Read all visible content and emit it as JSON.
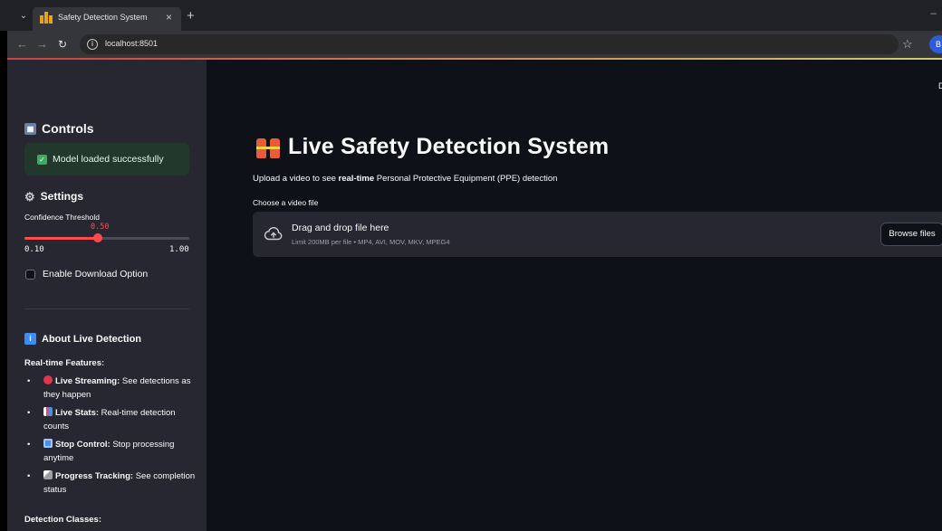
{
  "browser": {
    "tab_title": "Safety Detection System",
    "tab_close": "×",
    "new_tab": "+",
    "url": "localhost:8501",
    "menu_glyph": "⌄",
    "minimize_glyph": "–",
    "profile_initial": "B"
  },
  "app": {
    "deploy_text": "De",
    "title": "Live Safety Detection System",
    "subtitle_prefix": "Upload a video to see ",
    "subtitle_bold": "real-time",
    "subtitle_suffix": " Personal Protective Equipment (PPE) detection"
  },
  "uploader": {
    "label": "Choose a video file",
    "drop_title": "Drag and drop file here",
    "drop_hint": "Limit 200MB per file • MP4, AVI, MOV, MKV, MPEG4",
    "browse_label": "Browse files"
  },
  "sidebar": {
    "controls_heading": "Controls",
    "success_message": "Model loaded successfully",
    "settings_heading": "Settings",
    "threshold_label": "Confidence Threshold",
    "threshold_value_text": "0.50",
    "threshold_value": 0.5,
    "slider_min": "0.10",
    "slider_max": "1.00",
    "slider_min_value": 0.1,
    "slider_max_value": 1.0,
    "download_label": "Enable Download Option",
    "about_heading": "About Live Detection",
    "features_heading": "Real-time Features:",
    "features": [
      {
        "icon": "record-circle-icon",
        "bold": "Live Streaming:",
        "text": " See detections as they happen"
      },
      {
        "icon": "bar-chart-icon",
        "bold": "Live Stats:",
        "text": " Real-time detection counts"
      },
      {
        "icon": "stop-button-icon",
        "bold": "Stop Control:",
        "text": " Stop processing anytime"
      },
      {
        "icon": "progress-chart-icon",
        "bold": "Progress Tracking:",
        "text": " See completion status"
      }
    ],
    "classes_heading": "Detection Classes:"
  },
  "colors": {
    "primary": "#ff4b4b",
    "sidebar_bg": "#262730",
    "main_bg": "#0e1117",
    "success_bg": "#21382b"
  }
}
